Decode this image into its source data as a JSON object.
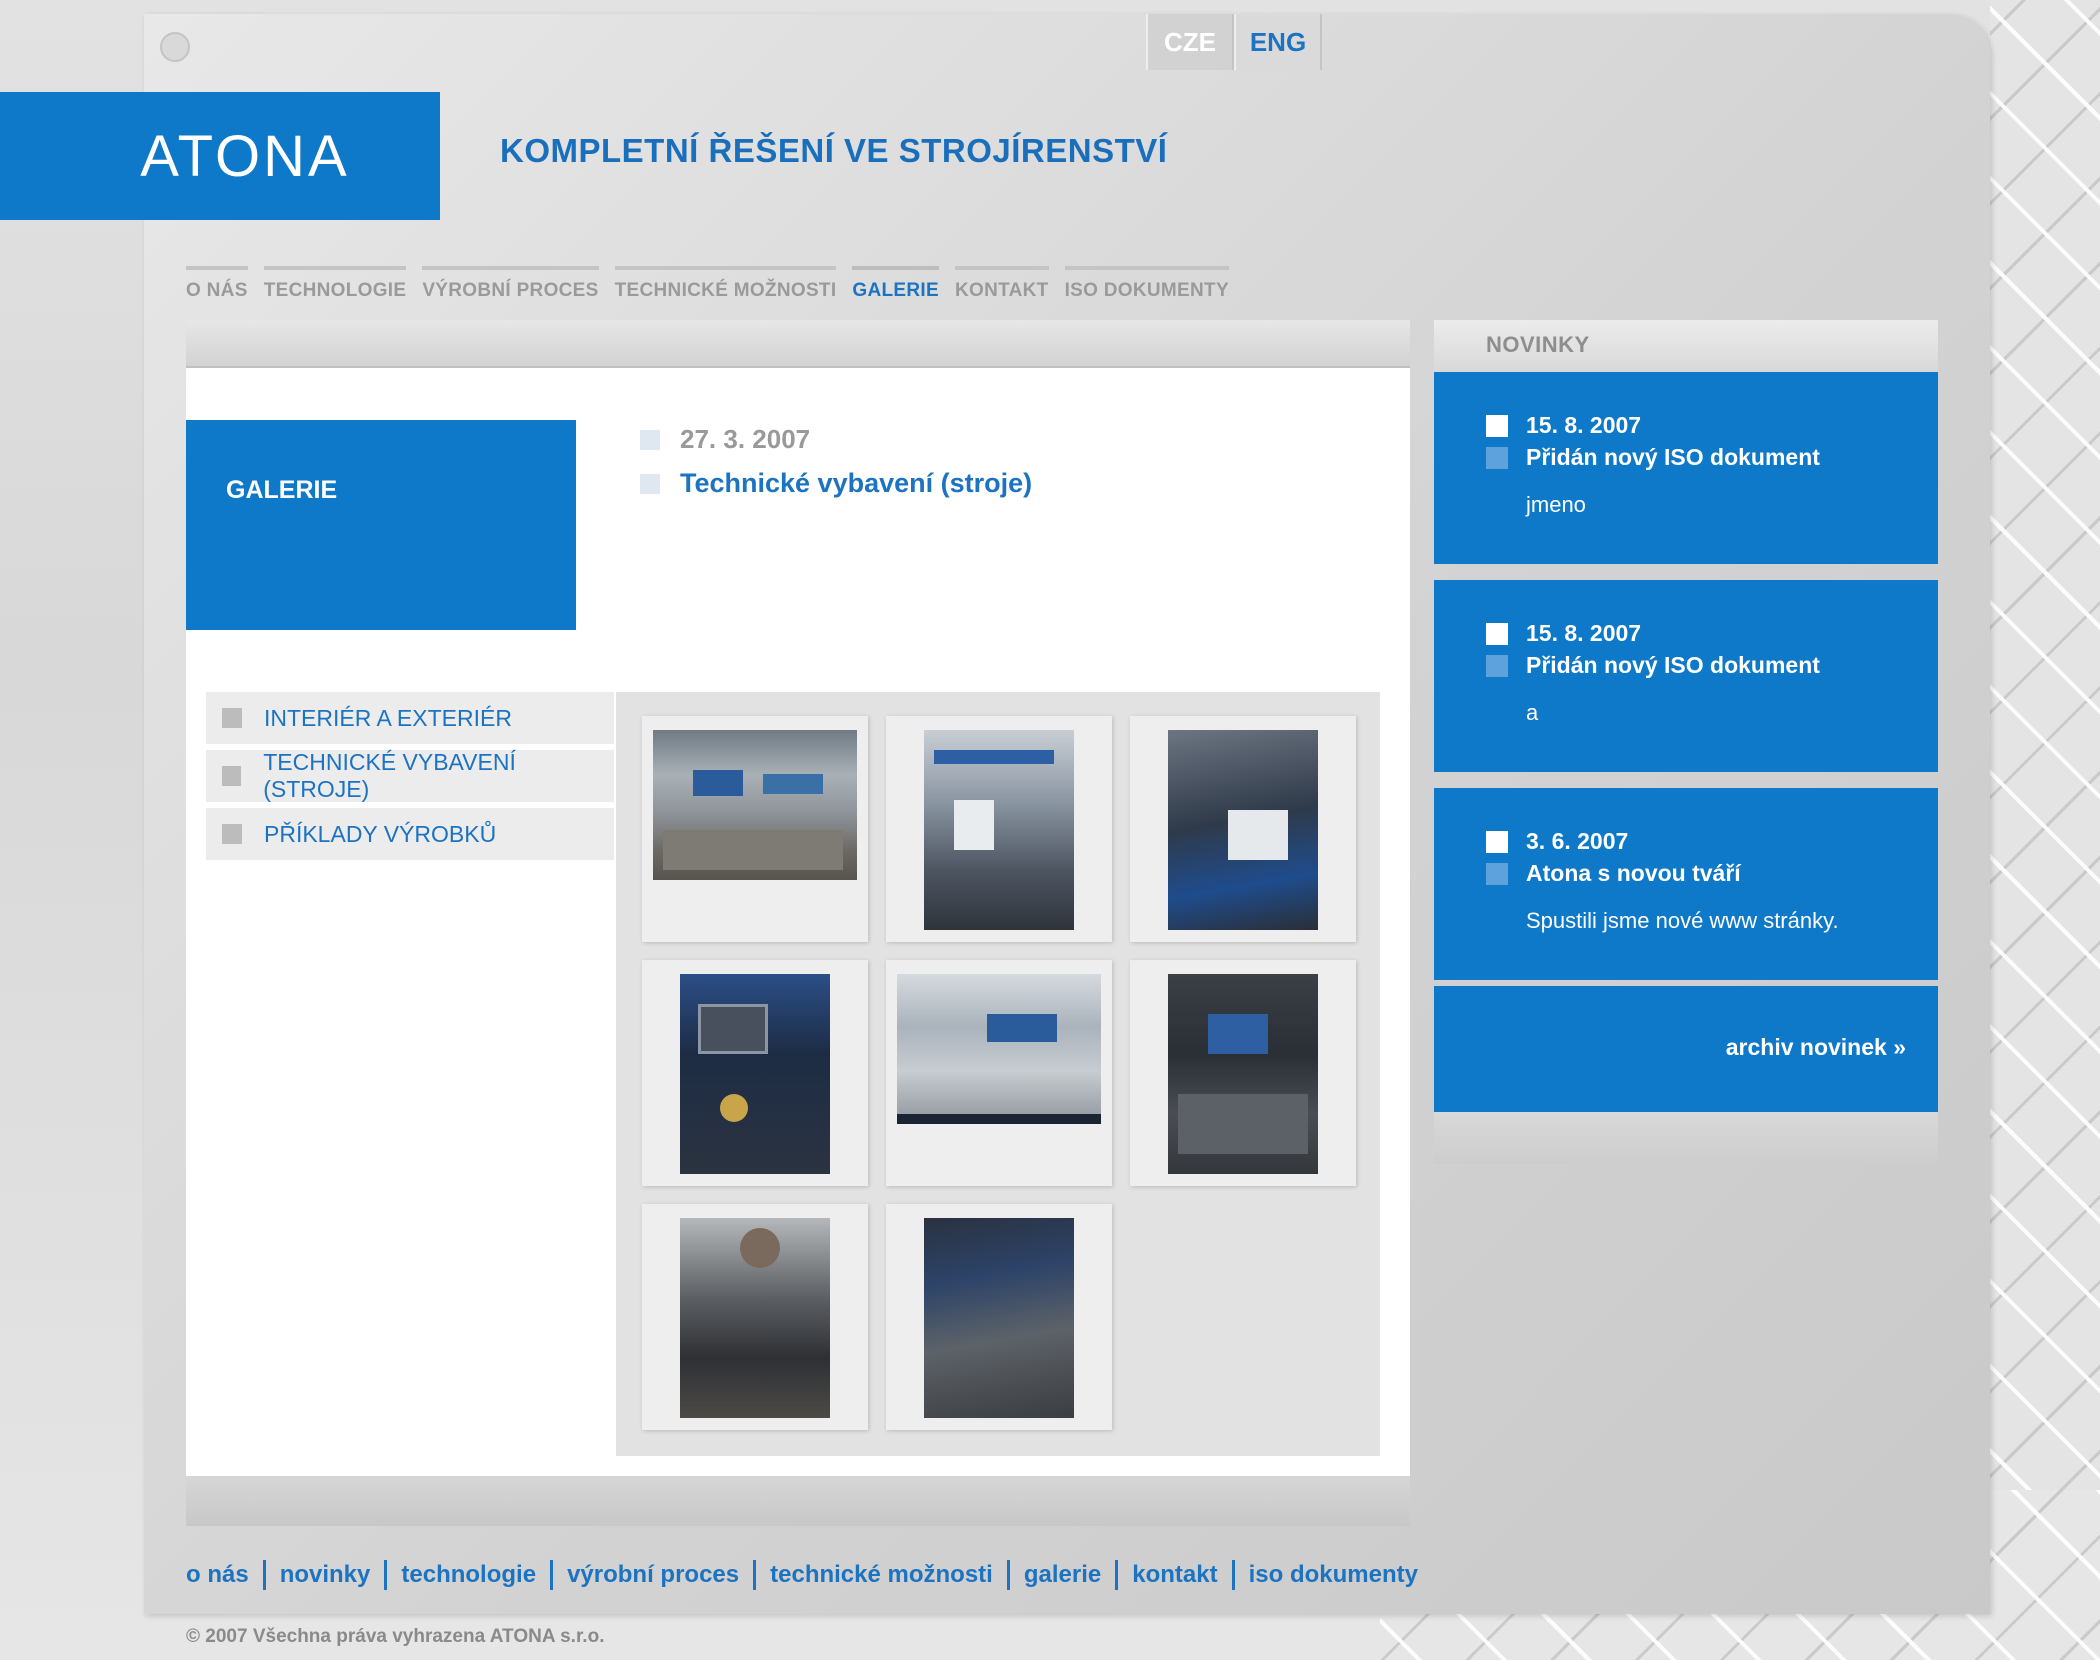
{
  "lang": {
    "cze": "CZE",
    "eng": "ENG"
  },
  "logo": {
    "text": "ATONA"
  },
  "tagline": "KOMPLETNÍ ŘEŠENÍ VE STROJÍRENSTVÍ",
  "nav": [
    "O NÁS",
    "TECHNOLOGIE",
    "VÝROBNÍ PROCES",
    "TECHNICKÉ MOŽNOSTI",
    "GALERIE",
    "KONTAKT",
    "ISO DOKUMENTY"
  ],
  "nav_active": "GALERIE",
  "section": {
    "title": "GALERIE",
    "date": "27. 3. 2007",
    "heading": "Technické vybavení (stroje)"
  },
  "submenu": [
    "INTERIÉR A EXTERIÉR",
    "TECHNICKÉ VYBAVENÍ (STROJE)",
    "PŘÍKLADY VÝROBKŮ"
  ],
  "gallery": {
    "photos": [
      {
        "name": "photo-factory-hall-icon",
        "orientation": "landscape"
      },
      {
        "name": "photo-laser-machine-icon",
        "orientation": "portrait"
      },
      {
        "name": "photo-machine-bed-icon",
        "orientation": "portrait"
      },
      {
        "name": "photo-control-panel-icon",
        "orientation": "portrait"
      },
      {
        "name": "photo-punching-machine-icon",
        "orientation": "landscape"
      },
      {
        "name": "photo-welding-icon",
        "orientation": "portrait"
      },
      {
        "name": "photo-worker-grinding-icon",
        "orientation": "portrait"
      },
      {
        "name": "photo-worker-welding-icon",
        "orientation": "portrait"
      }
    ]
  },
  "sidebar": {
    "title": "NOVINKY",
    "news": [
      {
        "date": "15. 8. 2007",
        "title": "Přidán nový ISO dokument",
        "text": "jmeno"
      },
      {
        "date": "15. 8. 2007",
        "title": "Přidán nový ISO dokument",
        "text": "a"
      },
      {
        "date": "3. 6. 2007",
        "title": "Atona s novou tváří",
        "text": "Spustili jsme nové www stránky."
      }
    ],
    "archive": "archiv novinek »"
  },
  "footer": {
    "links": [
      "o nás",
      "novinky",
      "technologie",
      "výrobní proces",
      "technické možnosti",
      "galerie",
      "kontakt",
      "iso dokumenty"
    ],
    "copyright": "© 2007 Všechna práva vyhrazena ATONA s.r.o."
  },
  "colors": {
    "brand_blue": "#0e78c9",
    "link_blue": "#1c73c1",
    "nav_gray": "#9a9a9a"
  }
}
